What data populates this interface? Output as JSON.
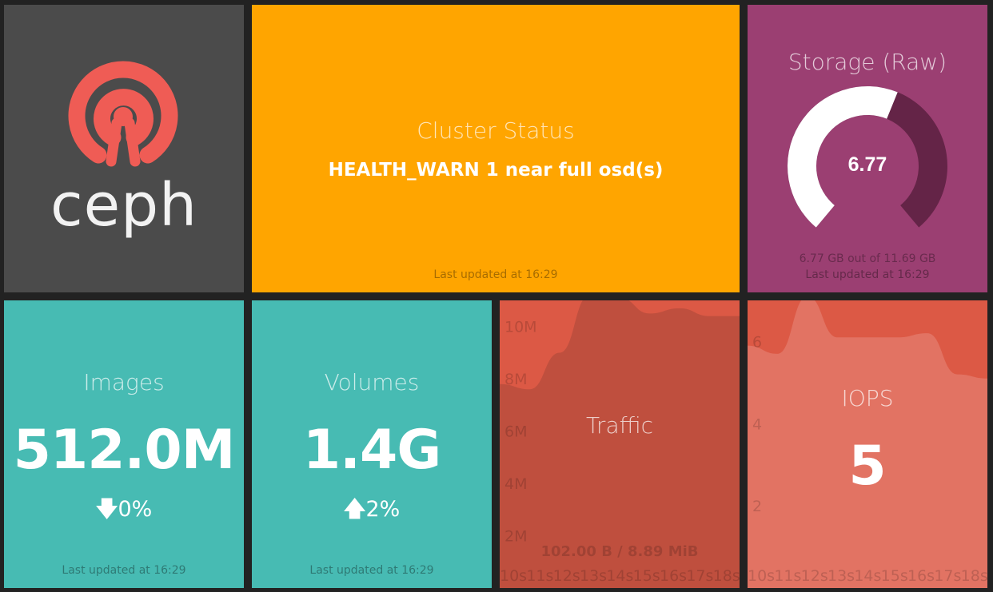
{
  "logo": {
    "text": "ceph",
    "brand_color": "#ef5c55"
  },
  "cluster": {
    "title": "Cluster Status",
    "status": "HEALTH_WARN 1 near full osd(s)",
    "updated": "Last updated at 16:29"
  },
  "storage": {
    "title": "Storage (Raw)",
    "value": "6.77",
    "more_info": "6.77 GB out of 11.69 GB",
    "updated": "Last updated at 16:29",
    "gauge": {
      "used": 6.77,
      "max": 11.69
    }
  },
  "images": {
    "title": "Images",
    "value": "512.0M",
    "change": "0%",
    "direction": "down",
    "updated": "Last updated at 16:29"
  },
  "volumes": {
    "title": "Volumes",
    "value": "1.4G",
    "change": "2%",
    "direction": "up",
    "updated": "Last updated at 16:29"
  },
  "traffic": {
    "title": "Traffic",
    "more_info": "102.00 B / 8.89 MiB"
  },
  "iops": {
    "title": "IOPS",
    "value": "5"
  },
  "chart_data": [
    {
      "type": "area",
      "title": "Traffic",
      "x": [
        "10s",
        "11s",
        "12s",
        "13s",
        "14s",
        "15s",
        "16s",
        "17s",
        "18s"
      ],
      "ylim": [
        0,
        11
      ],
      "yticks": [
        "10M",
        "8M",
        "6M",
        "4M",
        "2M"
      ],
      "ytick_values": [
        10,
        8,
        6,
        4,
        2
      ],
      "series": [
        {
          "values": [
            7.8,
            7.6,
            9.0,
            11.2,
            11.1,
            10.5,
            10.7,
            10.4,
            10.4
          ]
        }
      ]
    },
    {
      "type": "area",
      "title": "IOPS",
      "x": [
        "10s",
        "11s",
        "12s",
        "13s",
        "14s",
        "15s",
        "16s",
        "17s",
        "18s"
      ],
      "ylim": [
        0,
        7
      ],
      "yticks": [
        "6",
        "4",
        "2"
      ],
      "ytick_values": [
        6,
        4,
        2
      ],
      "series": [
        {
          "values": [
            5.9,
            5.7,
            7.1,
            6.1,
            6.1,
            6.1,
            6.2,
            5.2,
            5.1
          ]
        }
      ]
    }
  ]
}
